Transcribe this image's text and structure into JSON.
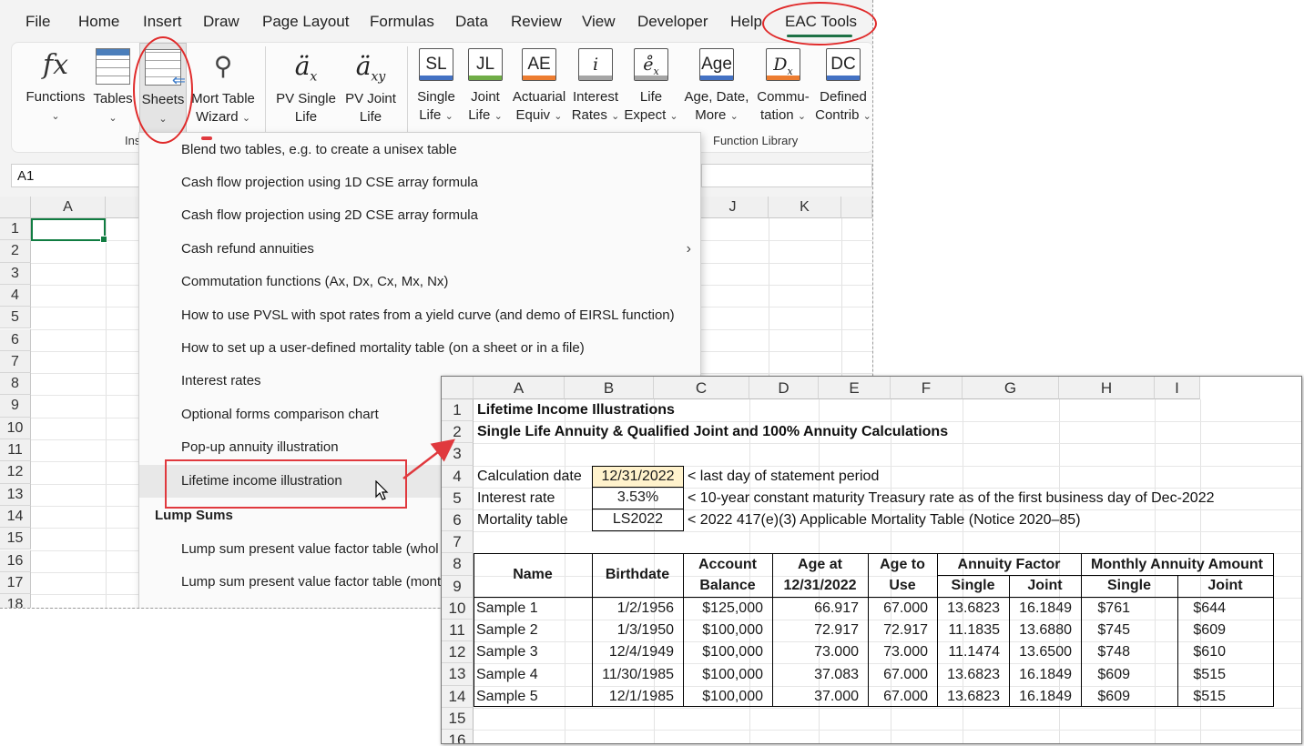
{
  "menu_tabs": [
    "File",
    "Home",
    "Insert",
    "Draw",
    "Page Layout",
    "Formulas",
    "Data",
    "Review",
    "View",
    "Developer",
    "Help",
    "EAC Tools"
  ],
  "ribbon": {
    "buttons": [
      {
        "label": "Functions",
        "sub": "",
        "icon": "fx"
      },
      {
        "label": "Tables",
        "sub": "",
        "icon": "table"
      },
      {
        "label": "Sheets",
        "sub": "",
        "icon": "sheets"
      },
      {
        "label": "Mort Table",
        "sub": "Wizard",
        "icon": "wand"
      },
      {
        "label": "PV Single",
        "sub": "Life",
        "icon": "ä_x"
      },
      {
        "label": "PV Joint",
        "sub": "Life",
        "icon": "ä_xy"
      },
      {
        "label": "Single",
        "sub": "Life",
        "icon": "SL"
      },
      {
        "label": "Joint",
        "sub": "Life",
        "icon": "JL"
      },
      {
        "label": "Actuarial",
        "sub": "Equiv",
        "icon": "AE"
      },
      {
        "label": "Interest",
        "sub": "Rates",
        "icon": "i"
      },
      {
        "label": "Life",
        "sub": "Expect",
        "icon": "e_x"
      },
      {
        "label": "Age, Date,",
        "sub": "More",
        "icon": "Age"
      },
      {
        "label": "Commu-",
        "sub": "tation",
        "icon": "D_x"
      },
      {
        "label": "Defined",
        "sub": "Contrib",
        "icon": "DC"
      }
    ],
    "group_left_partial": "Ins",
    "group_function_library": "Function Library"
  },
  "name_box": "A1",
  "bg_sheet": {
    "columns": [
      "A",
      "J",
      "K"
    ],
    "rows": [
      "1",
      "2",
      "3",
      "4",
      "5",
      "6",
      "7",
      "8",
      "9",
      "10",
      "11",
      "12",
      "13",
      "14",
      "15",
      "16",
      "17",
      "18"
    ]
  },
  "dropdown": {
    "items": [
      "Blend two tables, e.g. to create a unisex table",
      "Cash flow projection using 1D CSE array formula",
      "Cash flow projection using 2D CSE array formula",
      "Cash refund annuities",
      "Commutation functions (Ax, Dx, Cx, Mx, Nx)",
      "How to use PVSL with spot rates from a yield curve (and demo of EIRSL function)",
      "How to set up a user-defined mortality table (on a sheet or in a file)",
      "Interest rates",
      "Optional forms comparison chart",
      "Pop-up annuity illustration",
      "Lifetime income illustration"
    ],
    "section": "Lump Sums",
    "section_items": [
      "Lump sum present value factor table (whol",
      "Lump sum present value factor table (mont"
    ]
  },
  "sheet": {
    "columns": [
      "A",
      "B",
      "C",
      "D",
      "E",
      "F",
      "G",
      "H",
      "I"
    ],
    "rows": [
      "1",
      "2",
      "3",
      "4",
      "5",
      "6",
      "7",
      "8",
      "9",
      "10",
      "11",
      "12",
      "13",
      "14",
      "15",
      "16"
    ],
    "title": "Lifetime Income Illustrations",
    "subtitle": "Single Life Annuity & Qualified Joint and 100% Annuity Calculations",
    "inputs": [
      {
        "label": "Calculation date",
        "value": "12/31/2022",
        "note": "< last day of statement period"
      },
      {
        "label": "Interest rate",
        "value": "3.53%",
        "note": "< 10-year constant maturity Treasury rate as of the first business day of Dec-2022"
      },
      {
        "label": "Mortality table",
        "value": "LS2022",
        "note": "< 2022 417(e)(3) Applicable Mortality Table (Notice 2020–85)"
      }
    ],
    "headers": {
      "name": "Name",
      "birthdate": "Birthdate",
      "account1": "Account",
      "account2": "Balance",
      "age_at1": "Age at",
      "age_at2": "12/31/2022",
      "age_use1": "Age to",
      "age_use2": "Use",
      "annuity_factor": "Annuity Factor",
      "monthly_amount": "Monthly Annuity Amount",
      "single": "Single",
      "joint": "Joint"
    },
    "data": [
      [
        "Sample 1",
        "1/2/1956",
        "$125,000",
        "66.917",
        "67.000",
        "13.6823",
        "16.1849",
        "$761",
        "$644"
      ],
      [
        "Sample 2",
        "1/3/1950",
        "$100,000",
        "72.917",
        "72.917",
        "11.1835",
        "13.6880",
        "$745",
        "$609"
      ],
      [
        "Sample 3",
        "12/4/1949",
        "$100,000",
        "73.000",
        "73.000",
        "11.1474",
        "13.6500",
        "$748",
        "$610"
      ],
      [
        "Sample 4",
        "11/30/1985",
        "$100,000",
        "37.083",
        "67.000",
        "13.6823",
        "16.1849",
        "$609",
        "$515"
      ],
      [
        "Sample 5",
        "12/1/1985",
        "$100,000",
        "37.000",
        "67.000",
        "13.6823",
        "16.1849",
        "$609",
        "$515"
      ]
    ]
  },
  "colors": {
    "accent_green": "#1e7145",
    "annotation_red": "#e02a2a",
    "input_fill": "#fff2cc"
  }
}
